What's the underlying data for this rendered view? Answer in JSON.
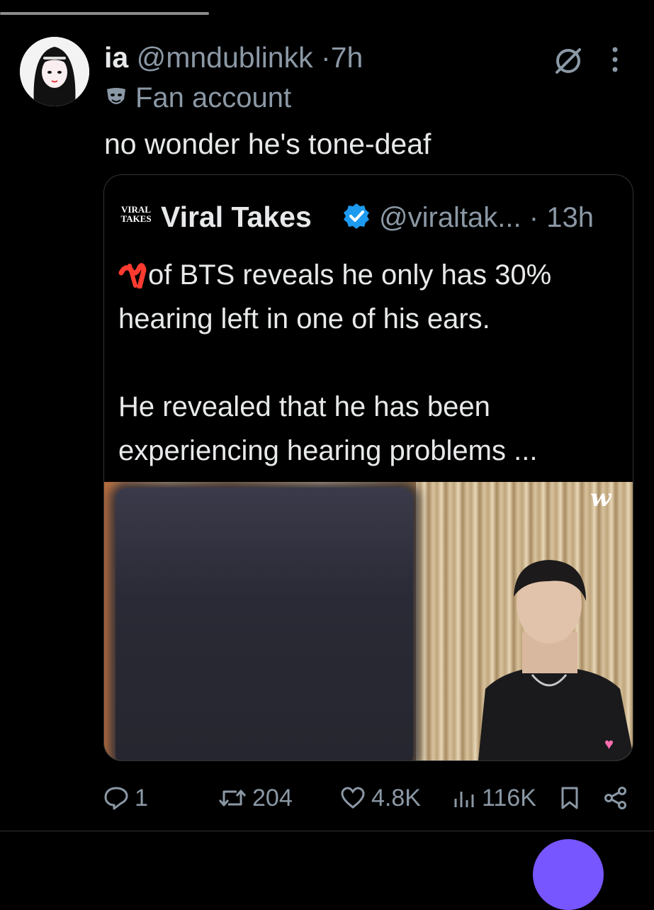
{
  "status": {},
  "post": {
    "display_name": "ia",
    "handle": "@mndublinkk",
    "separator": "·",
    "time": "7h",
    "account_label": "Fan account",
    "text": "no wonder he's tone-deaf",
    "avatar_icon": "avatar-illustration-icon"
  },
  "quote": {
    "logo_line1": "VIRAL",
    "logo_line2": "TAKES",
    "name": "Viral Takes",
    "handle": "@viraltak...",
    "separator": "·",
    "time": "13h",
    "text_line1": "of BTS reveals he only has 30%",
    "text_line2": "hearing left in one of his ears.",
    "text_line3": "He revealed that he has been",
    "text_line4": "experiencing hearing problems ...",
    "media_watermark": "w",
    "verified_color": "#1d9bf0"
  },
  "actions": {
    "replies": "1",
    "reposts": "204",
    "likes": "4.8K",
    "views": "116K"
  },
  "colors": {
    "background": "#000000",
    "text": "#e7e9ea",
    "muted": "#8b98a5",
    "fab": "#7856ff"
  }
}
